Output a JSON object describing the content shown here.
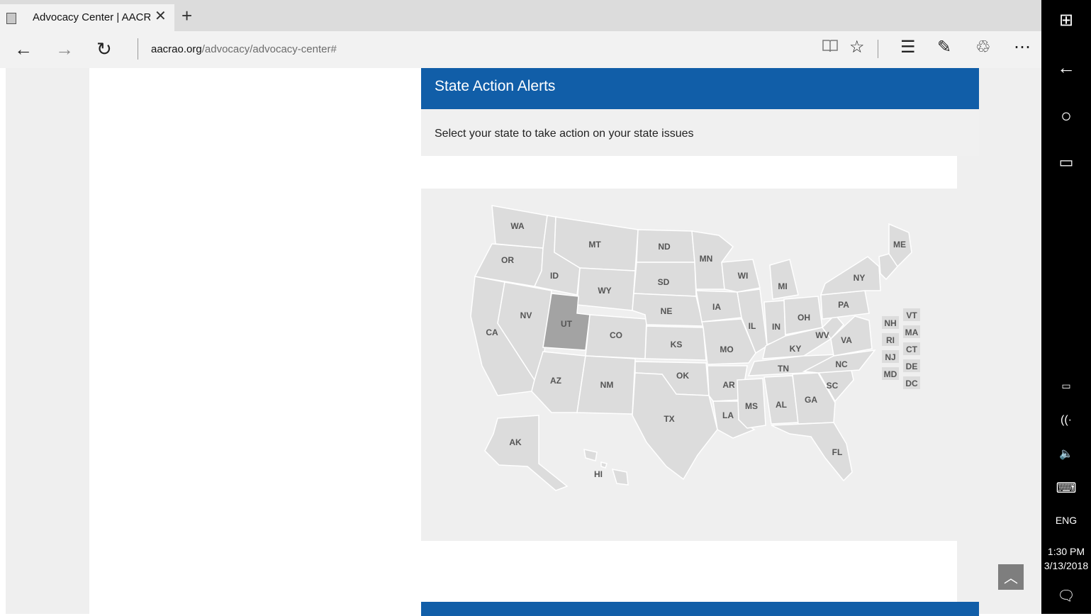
{
  "browser": {
    "tab_title": "Advocacy Center | AACRAO",
    "tab_close": "✕",
    "new_tab": "+",
    "url_domain": "aacrao.org",
    "url_path": "/advocacy/advocacy-center#",
    "icons": {
      "back": "←",
      "forward": "→",
      "refresh": "↻",
      "reading_view": "📖",
      "favorite": "☆",
      "hub": "☰",
      "web_note": "✎",
      "share": "♲",
      "more": "⋯"
    }
  },
  "page": {
    "alert_title": "State Action Alerts",
    "alert_description": "Select your state to take action on your state issues",
    "highlight_color": "#a3a3a3",
    "state_fill": "#dcdcdc",
    "header_color": "#115ea8",
    "scroll_top_icon": "︿"
  },
  "map": {
    "selected_state": "UT",
    "states": [
      "WA",
      "OR",
      "CA",
      "ID",
      "NV",
      "MT",
      "WY",
      "UT",
      "CO",
      "AZ",
      "NM",
      "ND",
      "SD",
      "NE",
      "KS",
      "OK",
      "TX",
      "MN",
      "IA",
      "MO",
      "AR",
      "LA",
      "WI",
      "IL",
      "MI",
      "IN",
      "OH",
      "KY",
      "TN",
      "MS",
      "AL",
      "GA",
      "FL",
      "SC",
      "NC",
      "VA",
      "WV",
      "PA",
      "NY",
      "ME",
      "AK",
      "HI"
    ],
    "small_states": [
      "NH",
      "VT",
      "RI",
      "MA",
      "NJ",
      "CT",
      "MD",
      "DE",
      "DC"
    ]
  },
  "taskbar": {
    "start": "⊞",
    "back": "←",
    "cortana": "○",
    "task_view": "▭",
    "battery": "▭",
    "wifi": "((·",
    "volume": "🔈",
    "keyboard": "⌨",
    "language": "ENG",
    "time": "1:30 PM",
    "date": "3/13/2018",
    "notifications": "🗨"
  }
}
